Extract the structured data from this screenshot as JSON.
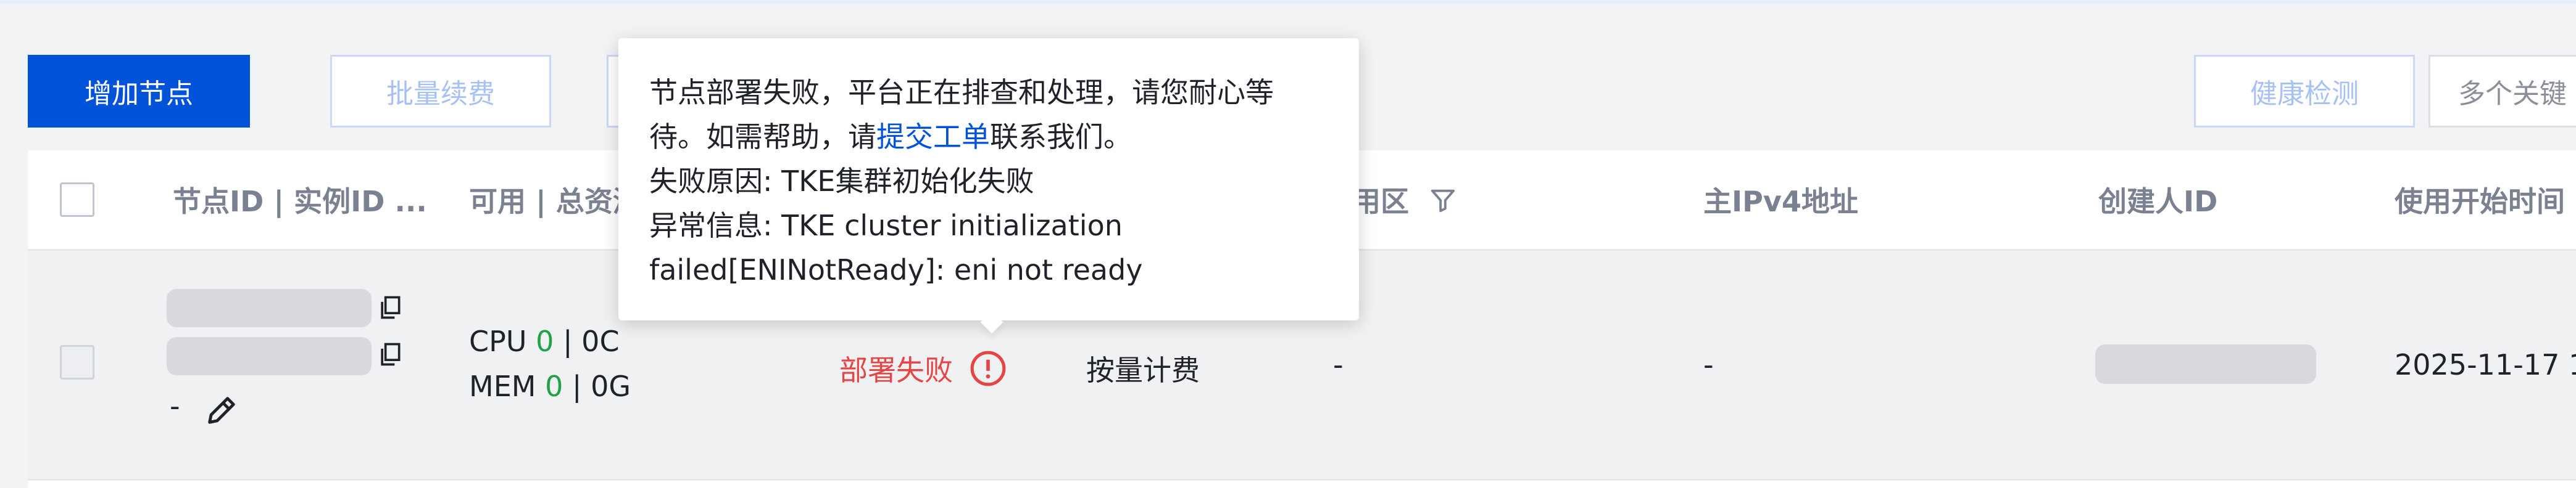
{
  "toolbar": {
    "add_node_label": "增加节点",
    "batch_renew_label": "批量续费",
    "health_check_label": "健康检测",
    "search_placeholder": "多个关键"
  },
  "table": {
    "headers": {
      "node_id": "节点ID | 实例ID ...",
      "available_total": "可用 | 总资源",
      "zone": "可用区",
      "ipv4": "主IPv4地址",
      "creator": "创建人ID",
      "start_time": "使用开始时间"
    },
    "row": {
      "node_remark": "-",
      "cpu_label": "CPU",
      "cpu_available": "0",
      "cpu_total": "| 0C",
      "mem_label": "MEM",
      "mem_available": "0",
      "mem_total": "| 0G",
      "status": "部署失败",
      "billing": "按量计费",
      "zone": "-",
      "ipv4": "-",
      "start_time": "2025-11-17 1"
    }
  },
  "tooltip": {
    "line1": "节点部署失败，平台正在排查和处理，请您耐心等",
    "line2_prefix": "待。如需帮助，请",
    "line2_link": "提交工单",
    "line2_suffix": "联系我们。",
    "line3": "失败原因: TKE集群初始化失败",
    "line4": "异常信息: TKE cluster initialization",
    "line5": "failed[ENINotReady]: eni not ready"
  },
  "colors": {
    "primary": "#0052d9",
    "error": "#e54545",
    "success": "#24a148"
  }
}
